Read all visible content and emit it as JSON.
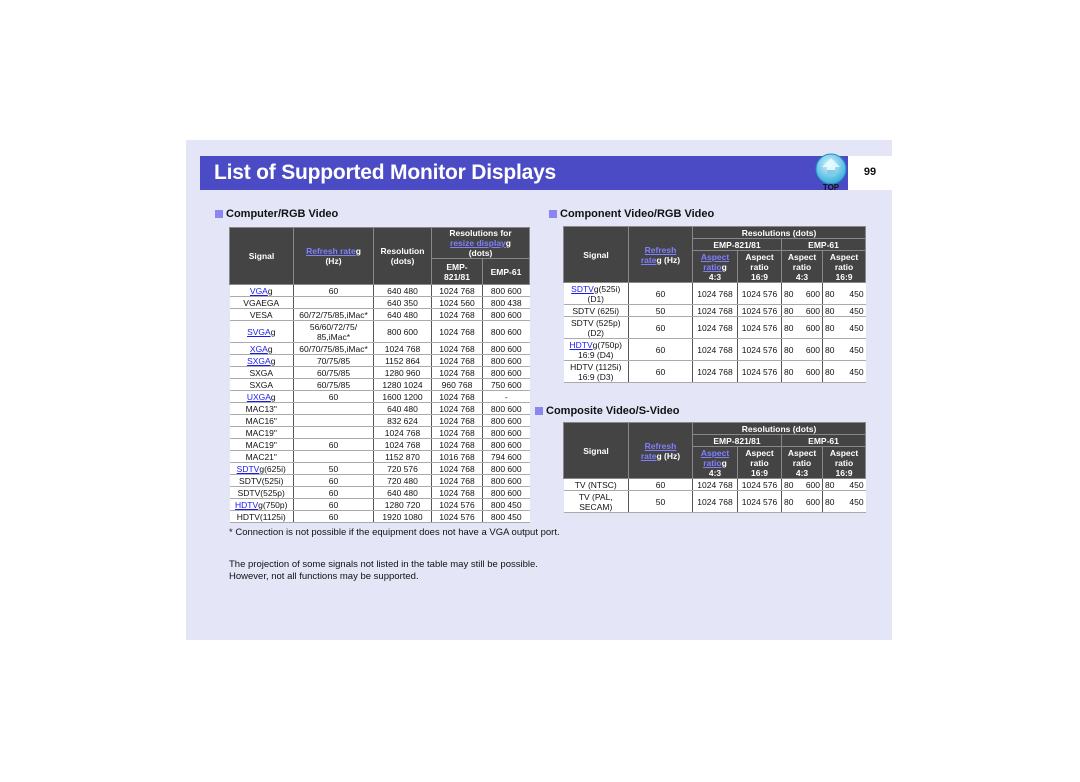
{
  "header": {
    "title": "List of Supported Monitor Displays",
    "top_icon_label": "TOP",
    "page_number": "99"
  },
  "colors": {
    "title_bar": "#4b4bc6",
    "page_background": "#e4e6f8",
    "table_header": "#444444",
    "link": "#1a1aee",
    "bullet": "#8a86ee"
  },
  "computer_rgb": {
    "heading": "Computer/RGB Video",
    "headers": {
      "signal": "Signal",
      "refresh_link": "Refresh rate",
      "refresh_suffix": "g",
      "refresh_unit": "(Hz)",
      "resolution": "Resolution",
      "resolution_unit": "(dots)",
      "resize_title": "Resolutions for",
      "resize_link": "resize display",
      "resize_suffix": "g",
      "resize_unit": "(dots)",
      "emp821": "EMP-821/81",
      "emp61": "EMP-61"
    },
    "rows": [
      {
        "signal": "VGA",
        "link": true,
        "suffix": "",
        "refresh": "60",
        "resolution": "640 480",
        "emp821": "1024 768",
        "emp61": "800 600"
      },
      {
        "signal": "VGAEGA",
        "link": false,
        "suffix": "",
        "refresh": "",
        "resolution": "640 350",
        "emp821": "1024 560",
        "emp61": "800 438"
      },
      {
        "signal": "VESA",
        "link": false,
        "suffix": "",
        "refresh": "60/72/75/85,iMac*",
        "resolution": "640 480",
        "emp821": "1024 768",
        "emp61": "800 600"
      },
      {
        "signal": "SVGA",
        "link": true,
        "suffix": "",
        "refresh": "56/60/72/75/ 85,iMac*",
        "resolution": "800 600",
        "emp821": "1024 768",
        "emp61": "800 600"
      },
      {
        "signal": "XGA",
        "link": true,
        "suffix": "",
        "refresh": "60/70/75/85,iMac*",
        "resolution": "1024 768",
        "emp821": "1024 768",
        "emp61": "800 600"
      },
      {
        "signal": "SXGA",
        "link": true,
        "suffix": "",
        "refresh": "70/75/85",
        "resolution": "1152 864",
        "emp821": "1024 768",
        "emp61": "800 600"
      },
      {
        "signal": "SXGA",
        "link": false,
        "suffix": "",
        "refresh": "60/75/85",
        "resolution": "1280 960",
        "emp821": "1024 768",
        "emp61": "800 600"
      },
      {
        "signal": "SXGA",
        "link": false,
        "suffix": "",
        "refresh": "60/75/85",
        "resolution": "1280 1024",
        "emp821": "960 768",
        "emp61": "750 600"
      },
      {
        "signal": "UXGA",
        "link": true,
        "suffix": "",
        "refresh": "60",
        "resolution": "1600 1200",
        "emp821": "1024 768",
        "emp61": "-"
      },
      {
        "signal": "MAC13\"",
        "link": false,
        "suffix": "",
        "refresh": "",
        "resolution": "640 480",
        "emp821": "1024 768",
        "emp61": "800 600"
      },
      {
        "signal": "MAC16\"",
        "link": false,
        "suffix": "",
        "refresh": "",
        "resolution": "832 624",
        "emp821": "1024 768",
        "emp61": "800 600"
      },
      {
        "signal": "MAC19\"",
        "link": false,
        "suffix": "",
        "refresh": "",
        "resolution": "1024 768",
        "emp821": "1024 768",
        "emp61": "800 600"
      },
      {
        "signal": "MAC19\"",
        "link": false,
        "suffix": "",
        "refresh": "60",
        "resolution": "1024 768",
        "emp821": "1024 768",
        "emp61": "800 600"
      },
      {
        "signal": "MAC21\"",
        "link": false,
        "suffix": "",
        "refresh": "",
        "resolution": "1152 870",
        "emp821": "1016 768",
        "emp61": "794 600"
      },
      {
        "signal": "SDTV",
        "link": true,
        "suffix": "(625i)",
        "refresh": "50",
        "resolution": "720 576",
        "emp821": "1024 768",
        "emp61": "800 600"
      },
      {
        "signal": "SDTV(525i)",
        "link": false,
        "suffix": "",
        "refresh": "60",
        "resolution": "720 480",
        "emp821": "1024 768",
        "emp61": "800 600"
      },
      {
        "signal": "SDTV(525p)",
        "link": false,
        "suffix": "",
        "refresh": "60",
        "resolution": "640 480",
        "emp821": "1024 768",
        "emp61": "800 600"
      },
      {
        "signal": "HDTV",
        "link": true,
        "suffix": "(750p)",
        "refresh": "60",
        "resolution": "1280 720",
        "emp821": "1024 576",
        "emp61": "800 450"
      },
      {
        "signal": "HDTV(1125i)",
        "link": false,
        "suffix": "",
        "refresh": "60",
        "resolution": "1920 1080",
        "emp821": "1024 576",
        "emp61": "800 450"
      }
    ],
    "footnote": "* Connection is not possible if the equipment does not have a VGA output port.",
    "note_line1": "The projection of some signals not listed in the table may still be possible.",
    "note_line2": "However, not all functions may be supported."
  },
  "component": {
    "heading": "Component Video/RGB Video",
    "headers": {
      "signal": "Signal",
      "refresh_link1": "Refresh",
      "refresh_link2": "rate",
      "refresh_suffix": "g",
      "refresh_unit": "(Hz)",
      "resolutions": "Resolutions (dots)",
      "emp821": "EMP-821/81",
      "emp61": "EMP-61",
      "aspect_link1": "Aspect",
      "aspect_link2": "ratio",
      "aspect_suffix": "g",
      "aspect": "Aspect",
      "ratio": "ratio",
      "r43": "4:3",
      "r169": "16:9"
    },
    "rows": [
      {
        "signal": "SDTV",
        "link": true,
        "suffix": "(525i)",
        "line2": "(D1)",
        "refresh": "60",
        "a": "1024 768",
        "b": "1024 576",
        "c1": "80",
        "c2": "600",
        "d1": "80",
        "d2": "450"
      },
      {
        "signal": "SDTV (625i)",
        "link": false,
        "suffix": "",
        "line2": "",
        "refresh": "50",
        "a": "1024 768",
        "b": "1024 576",
        "c1": "80",
        "c2": "600",
        "d1": "80",
        "d2": "450"
      },
      {
        "signal": "SDTV (525p)",
        "link": false,
        "suffix": "",
        "line2": "(D2)",
        "refresh": "60",
        "a": "1024 768",
        "b": "1024 576",
        "c1": "80",
        "c2": "600",
        "d1": "80",
        "d2": "450"
      },
      {
        "signal": "HDTV",
        "link": true,
        "suffix": "(750p)",
        "line2": "16:9 (D4)",
        "refresh": "60",
        "a": "1024 768",
        "b": "1024 576",
        "c1": "80",
        "c2": "600",
        "d1": "80",
        "d2": "450"
      },
      {
        "signal": "HDTV (1125i)",
        "link": false,
        "suffix": "",
        "line2": "16:9 (D3)",
        "refresh": "60",
        "a": "1024 768",
        "b": "1024 576",
        "c1": "80",
        "c2": "600",
        "d1": "80",
        "d2": "450"
      }
    ]
  },
  "composite": {
    "heading": "Composite Video/S-Video",
    "rows": [
      {
        "signal": "TV (NTSC)",
        "line2": "",
        "refresh": "60",
        "a": "1024 768",
        "b": "1024 576",
        "c1": "80",
        "c2": "600",
        "d1": "80",
        "d2": "450"
      },
      {
        "signal": "TV (PAL,",
        "line2": "SECAM)",
        "refresh": "50",
        "a": "1024 768",
        "b": "1024 576",
        "c1": "80",
        "c2": "600",
        "d1": "80",
        "d2": "450"
      }
    ]
  }
}
